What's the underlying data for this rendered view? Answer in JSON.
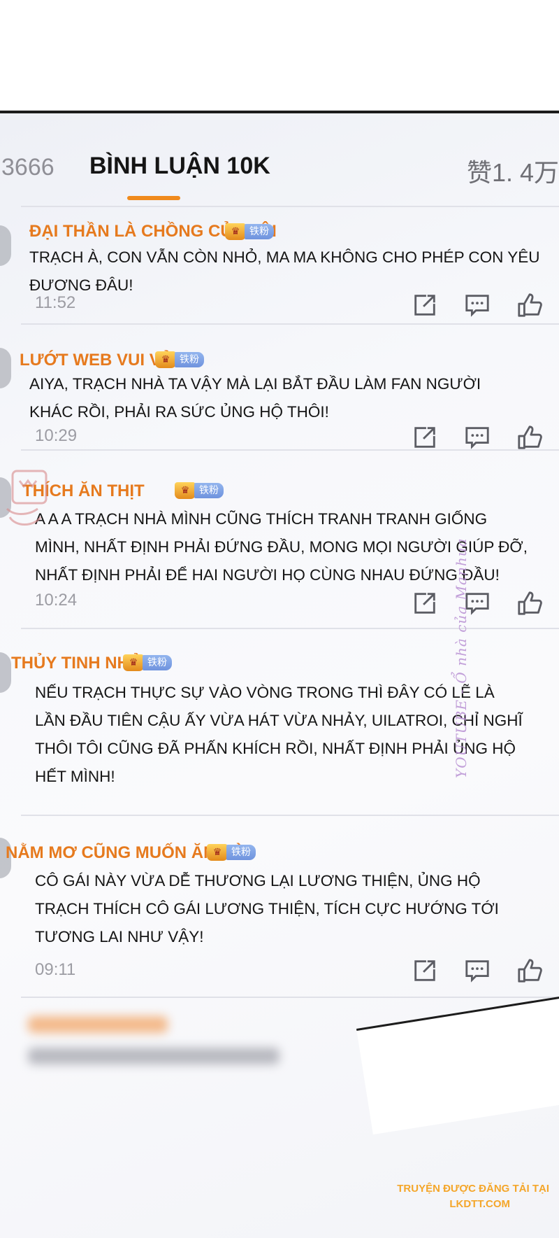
{
  "tabs": {
    "count": "3666",
    "comments": "BÌNH LUẬN 10K",
    "likes": "赞1. 4万"
  },
  "comments": [
    {
      "username": "ĐẠI THẦN LÀ CHỒNG CỦA TÔI",
      "badge": "铁粉",
      "lines": [
        "TRẠCH À, CON VẪN CÒN NHỎ, MA MA KHÔNG CHO PHÉP CON YÊU ĐƯƠNG ĐÂU!"
      ],
      "time": "11:52"
    },
    {
      "username": "LƯỚT WEB VUI VẺ",
      "badge": "铁粉",
      "lines": [
        "AIYA, TRẠCH NHÀ TA VẬY MÀ LẠI BẮT ĐẦU LÀM FAN NGƯỜI",
        "KHÁC RỒI, PHẢI RA SỨC ỦNG HỘ THÔI!"
      ],
      "time": "10:29"
    },
    {
      "username": "THÍCH ĂN THỊT",
      "badge": "铁粉",
      "lines": [
        "A A A TRẠCH NHÀ MÌNH CŨNG THÍCH TRANH TRANH GIỐNG",
        "MÌNH, NHẤT ĐỊNH PHẢI ĐỨNG ĐẦU, MONG MỌI NGƯỜI GIÚP ĐỠ,",
        "NHẤT ĐỊNH PHẢI ĐỂ HAI NGƯỜI HỌ CÙNG NHAU ĐỨNG ĐẦU!"
      ],
      "time": "10:24"
    },
    {
      "username": "THỦY TINH NHỎ",
      "badge": "铁粉",
      "lines": [
        "NẾU TRẠCH THỰC SỰ VÀO VÒNG TRONG THÌ ĐÂY CÓ LẼ LÀ",
        "LẦN ĐẦU TIÊN CẬU ẤY VỪA HÁT VỪA NHẢY, UILATROI, CHỈ NGHĨ",
        "THÔI TÔI CŨNG ĐÃ PHẤN KHÍCH RỒI, NHẤT ĐỊNH PHẢI ỦNG HỘ",
        "HẾT MÌNH!"
      ],
      "time": ""
    },
    {
      "username": "NẰM MƠ CŨNG MUỐN ĂN GÀ",
      "badge": "铁粉",
      "lines": [
        "CÔ GÁI NÀY VỪA DỄ THƯƠNG LẠI LƯƠNG THIỆN, ỦNG HỘ",
        "TRẠCH THÍCH CÔ GÁI LƯƠNG THIỆN, TÍCH CỰC HƯỚNG TỚI",
        "TƯƠNG LAI NHƯ VẬY!"
      ],
      "time": "09:11"
    }
  ],
  "watermark": "YOUTUBE - Ổ nhà của Manhua",
  "footer": {
    "line1": "TRUYỆN ĐƯỢC ĐĂNG TẢI TẠI",
    "line2": "LKDTT.COM"
  },
  "colors": {
    "username": "#e67a1e",
    "badge_fan": "#7b9ce3",
    "tab_underline": "#f08a1d",
    "footer": "#f4a62a"
  },
  "icons": [
    "share-icon",
    "reply-icon",
    "thumbs-up-icon",
    "crown-icon"
  ]
}
